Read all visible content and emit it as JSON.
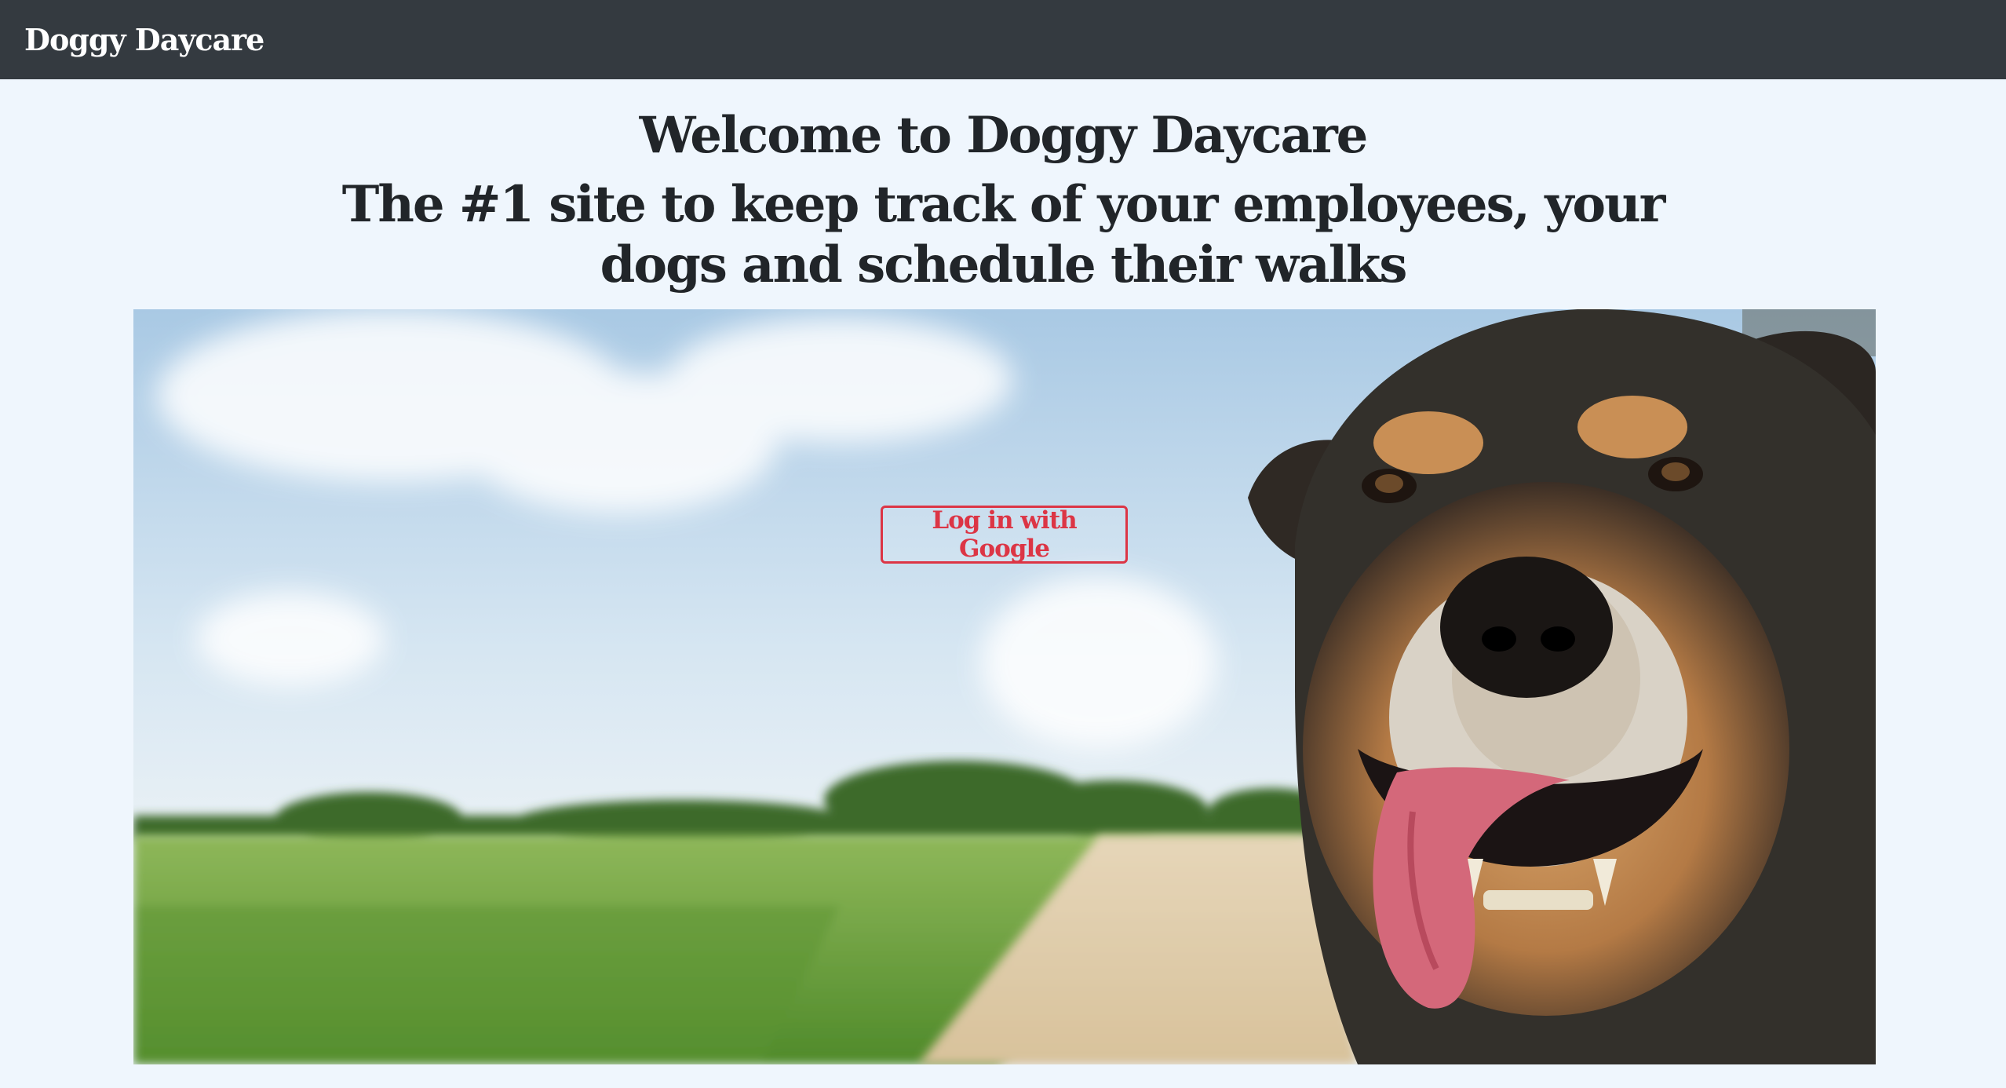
{
  "navbar": {
    "brand": "Doggy Daycare",
    "background_color": "#343a40"
  },
  "main": {
    "heading": "Welcome to Doggy Daycare",
    "subheading": "The #1 site to keep track of your employees, your dogs and schedule their walks"
  },
  "hero": {
    "image": "happy-dog-car-window-photo",
    "login_button_label": "Log in with Google",
    "login_button_color": "#dc3545"
  },
  "page": {
    "background_color": "#eff6fd"
  }
}
